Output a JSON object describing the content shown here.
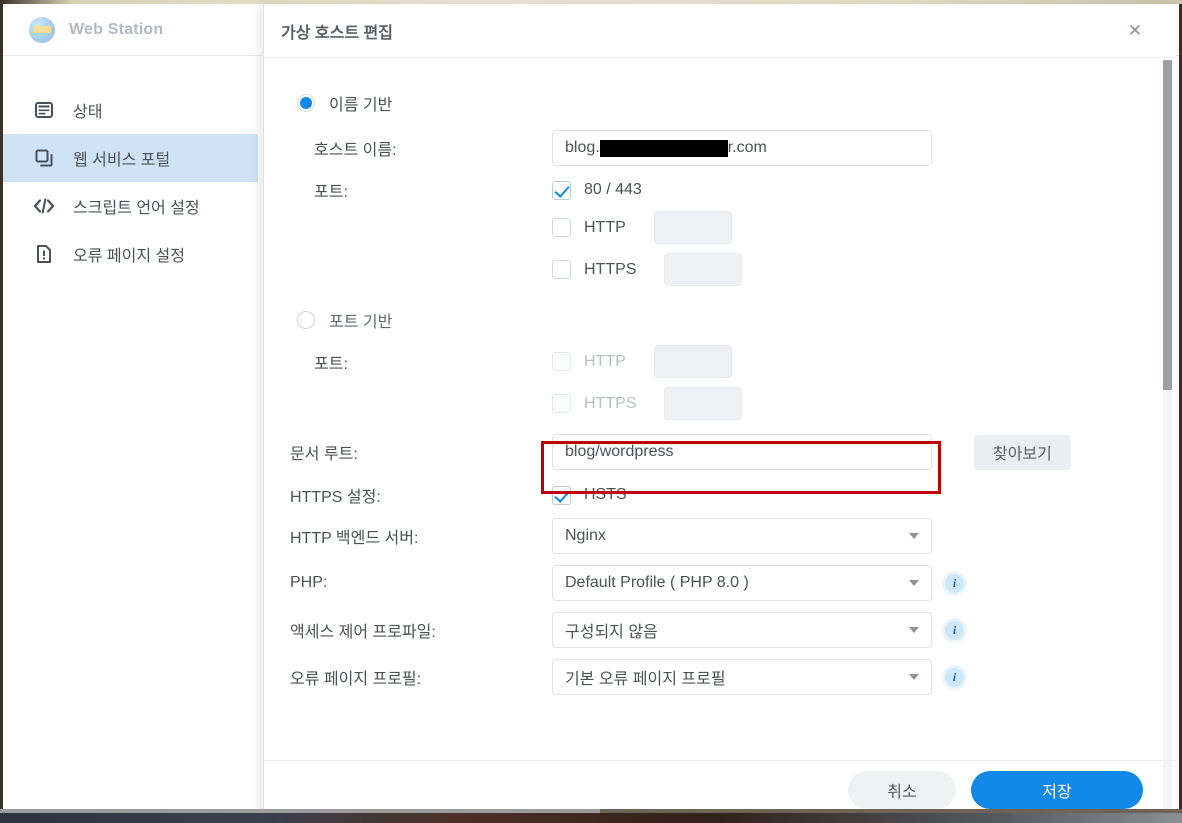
{
  "app": {
    "title": "Web Station",
    "logo_text": "WWW"
  },
  "sidebar": {
    "items": [
      {
        "label": "상태",
        "icon": "status-icon"
      },
      {
        "label": "웹 서비스 포털",
        "icon": "portal-icon"
      },
      {
        "label": "스크립트 언어 설정",
        "icon": "code-icon"
      },
      {
        "label": "오류 페이지 설정",
        "icon": "error-page-icon"
      }
    ]
  },
  "dialog": {
    "title": "가상 호스트 편집",
    "close_label": "✕",
    "name_based": {
      "radio_label": "이름 기반",
      "host_name_label": "호스트 이름:",
      "host_name_prefix": "blog.",
      "host_name_suffix": "r.com",
      "port_label": "포트:",
      "default_ports_label": "80 / 443",
      "http_label": "HTTP",
      "http_value": "",
      "https_label": "HTTPS",
      "https_value": ""
    },
    "port_based": {
      "radio_label": "포트 기반",
      "port_label": "포트:",
      "http_label": "HTTP",
      "http_value": "",
      "https_label": "HTTPS",
      "https_value": ""
    },
    "doc_root_label": "문서 루트:",
    "doc_root_value": "blog/wordpress",
    "browse_label": "찾아보기",
    "https_settings_label": "HTTPS 설정:",
    "hsts_label": "HSTS",
    "backend_label": "HTTP 백엔드 서버:",
    "backend_value": "Nginx",
    "php_label": "PHP:",
    "php_value": "Default Profile ( PHP 8.0 )",
    "access_control_label": "액세스 제어 프로파일:",
    "access_control_value": "구성되지 않음",
    "error_page_label": "오류 페이지 프로필:",
    "error_page_value": "기본 오류 페이지 프로필",
    "info_icon": "info-icon",
    "cancel_label": "취소",
    "save_label": "저장"
  },
  "colors": {
    "accent": "#1289e8",
    "highlight_box": "#c00000",
    "sidebar_active": "#cfe3f7",
    "info_badge": "#cfe7fa"
  }
}
